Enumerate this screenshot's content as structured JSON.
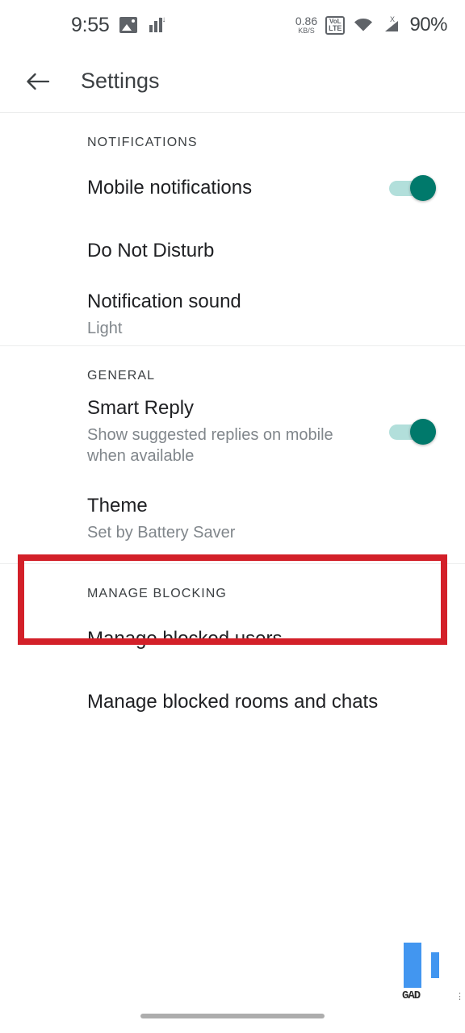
{
  "status_bar": {
    "clock": "9:55",
    "left_icons": [
      "photo-icon",
      "data-stats-icon"
    ],
    "net_speed_value": "0.86",
    "net_speed_unit": "KB/S",
    "volte_top": "VoL",
    "volte_bottom": "LTE",
    "right_icons": [
      "volte-icon",
      "wifi-icon",
      "cellular-signal-no-service-icon"
    ],
    "battery": "90%"
  },
  "toolbar": {
    "back_label": "back-arrow",
    "title": "Settings"
  },
  "sections": [
    {
      "header": "NOTIFICATIONS",
      "rows": [
        {
          "title": "Mobile notifications",
          "subtitle": "",
          "control": "toggle",
          "toggle_on": true
        },
        {
          "title": "Do Not Disturb",
          "subtitle": "",
          "control": "none",
          "toggle_on": false
        },
        {
          "title": "Notification sound",
          "subtitle": "Light",
          "control": "none",
          "toggle_on": false
        }
      ]
    },
    {
      "header": "GENERAL",
      "rows": [
        {
          "title": "Smart Reply",
          "subtitle": "Show suggested replies on mobile when available",
          "control": "toggle",
          "toggle_on": true
        },
        {
          "title": "Theme",
          "subtitle": "Set by Battery Saver",
          "control": "none",
          "toggle_on": false
        }
      ]
    },
    {
      "header": "MANAGE BLOCKING",
      "rows": [
        {
          "title": "Manage blocked users",
          "subtitle": "",
          "control": "none",
          "toggle_on": false
        },
        {
          "title": "Manage blocked rooms and chats",
          "subtitle": "",
          "control": "none",
          "toggle_on": false
        }
      ]
    }
  ],
  "annotation": {
    "type": "red-rectangle-highlight",
    "target_row": "Theme",
    "color": "#d32029"
  },
  "watermark": {
    "text": "GAD"
  },
  "colors": {
    "toggle_thumb_on": "#00796b",
    "toggle_track_on": "#b2dfdb",
    "title_text": "#202124",
    "subtitle_text": "#80868b",
    "divider": "#eceded",
    "background": "#ffffff",
    "watermark_blue": "#4296f0"
  }
}
